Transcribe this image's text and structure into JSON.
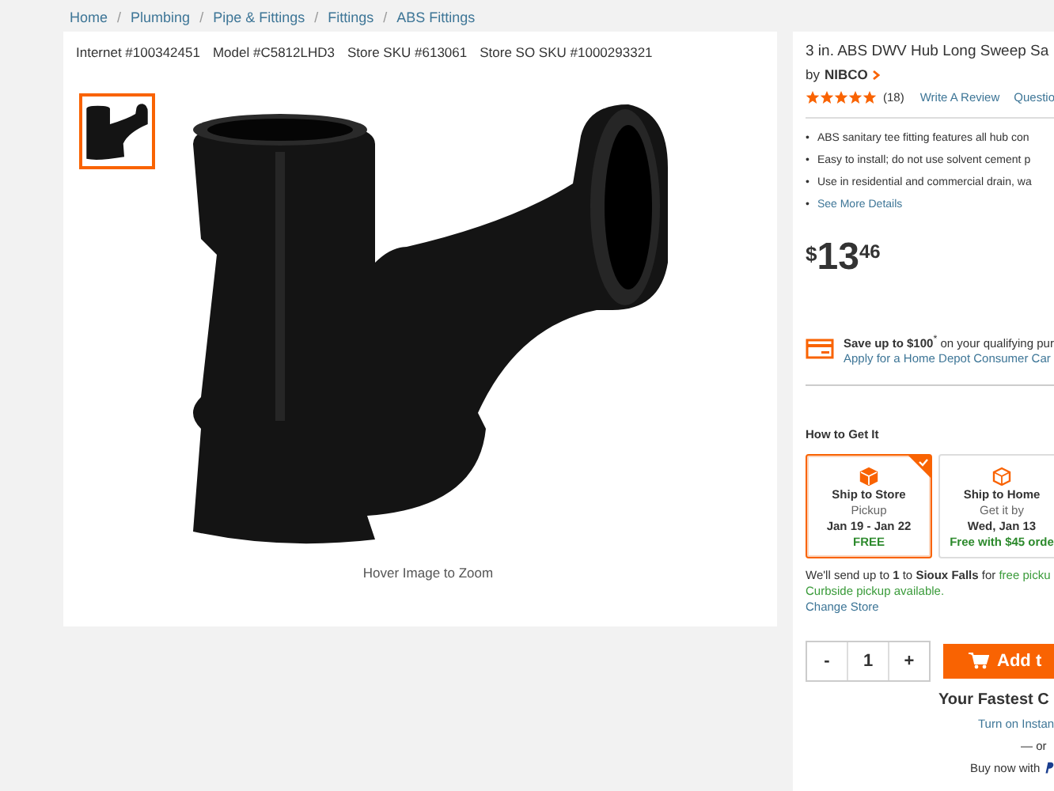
{
  "breadcrumbs": [
    {
      "label": "Home"
    },
    {
      "label": "Plumbing",
      "separator": "/"
    },
    {
      "label": "Pipe & Fittings",
      "separator": "/"
    },
    {
      "label": "Fittings",
      "separator": "/"
    },
    {
      "label": "ABS Fittings",
      "separator": "/"
    }
  ],
  "identifiers": [
    "Internet #100342451",
    "Model #C5812LHD3",
    "Store SKU #613061",
    "Store SO SKU #1000293321"
  ],
  "thumbnails": [
    {
      "selected": true
    }
  ],
  "image_caption": "Hover Image to Zoom",
  "product": {
    "title": "3 in. ABS DWV Hub Long Sweep Sa",
    "by": "by",
    "brand": "NIBCO",
    "stars": 5,
    "review_count": "(18)",
    "write_review": "Write A Review",
    "questions": "Questio",
    "bullets": [
      {
        "kind": "text",
        "marker": "•",
        "text": "ABS sanitary tee fitting features all hub con"
      },
      {
        "kind": "text",
        "marker": "•",
        "text": "Easy to install; do not use solvent cement p"
      },
      {
        "kind": "text",
        "marker": "•",
        "text": "Use in residential and commercial drain, wa"
      },
      {
        "kind": "link",
        "marker": "•",
        "text": "See More Details"
      }
    ],
    "price": {
      "currency": "$",
      "dollars": "13",
      "cents": "46"
    },
    "credit_offer": {
      "text": "**Save up to $100**$^{*}$ on your qualifying pur",
      "link": "Apply for a Home Depot Consumer Car"
    },
    "how_to_get_it": "How to Get It",
    "fulfillment_options": [
      {
        "title": "Ship to Store",
        "line_1": "Pickup",
        "line_2": "Jan 19 - Jan 22",
        "price": "FREE",
        "selected": true
      },
      {
        "title": "Ship to Home",
        "line_1": "Get it by",
        "line_2": "Wed, Jan 13",
        "price": "Free with $45 orde",
        "selected": false
      }
    ],
    "pickup_note": {
      "text": "We'll send up to **1** to **Sioux Falls** for ",
      "link": "free picku"
    },
    "curbside": "Curbside pickup available.",
    "change_store": "Change Store",
    "quantity": {
      "minus": "-",
      "value": "1",
      "plus": "+"
    },
    "add_to_cart": "Add t",
    "fastest_checkout": "Your Fastest C",
    "instant_checkout": "Turn on Instan",
    "or": "— or",
    "buy_now": "Buy now with"
  }
}
